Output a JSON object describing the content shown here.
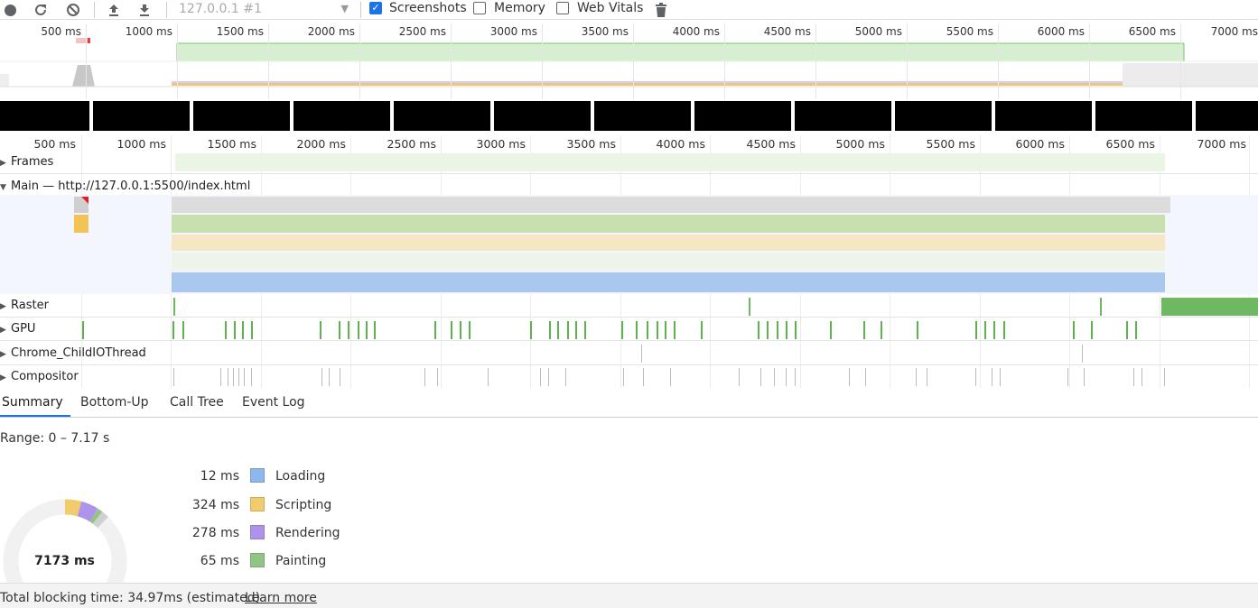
{
  "toolbar": {
    "target": "127.0.0.1 #1",
    "screenshots_label": "Screenshots",
    "screenshots_checked": true,
    "memory_label": "Memory",
    "memory_checked": false,
    "webvitals_label": "Web Vitals",
    "webvitals_checked": false,
    "icons": [
      "record-icon",
      "reload-icon",
      "clear-icon",
      "upload-icon",
      "download-icon",
      "trash-icon"
    ]
  },
  "overview_ticks": [
    "500 ms",
    "1000 ms",
    "1500 ms",
    "2000 ms",
    "2500 ms",
    "3000 ms",
    "3500 ms",
    "4000 ms",
    "4500 ms",
    "5000 ms",
    "5500 ms",
    "6000 ms",
    "6500 ms",
    "7000 ms"
  ],
  "main_ticks": [
    "500 ms",
    "1000 ms",
    "1500 ms",
    "2000 ms",
    "2500 ms",
    "3000 ms",
    "3500 ms",
    "4000 ms",
    "4500 ms",
    "5000 ms",
    "5500 ms",
    "6000 ms",
    "6500 ms",
    "7000 ms"
  ],
  "tracks": {
    "frames": "Frames",
    "main": "Main — http://127.0.0.1:5500/index.html",
    "raster": "Raster",
    "gpu": "GPU",
    "io": "Chrome_ChildIOThread",
    "compositor": "Compositor"
  },
  "tabs": [
    "Summary",
    "Bottom-Up",
    "Call Tree",
    "Event Log"
  ],
  "active_tab": "Summary",
  "range": "Range: 0 – 7.17 s",
  "summary": {
    "total": "7173 ms",
    "items": [
      {
        "value": "12 ms",
        "label": "Loading",
        "color": "#8eb7ee"
      },
      {
        "value": "324 ms",
        "label": "Scripting",
        "color": "#f2cb6d"
      },
      {
        "value": "278 ms",
        "label": "Rendering",
        "color": "#ae93ea"
      },
      {
        "value": "65 ms",
        "label": "Painting",
        "color": "#92c584"
      }
    ]
  },
  "footer": {
    "text": "Total blocking time: 34.97ms (estimated)",
    "link": "Learn more"
  }
}
